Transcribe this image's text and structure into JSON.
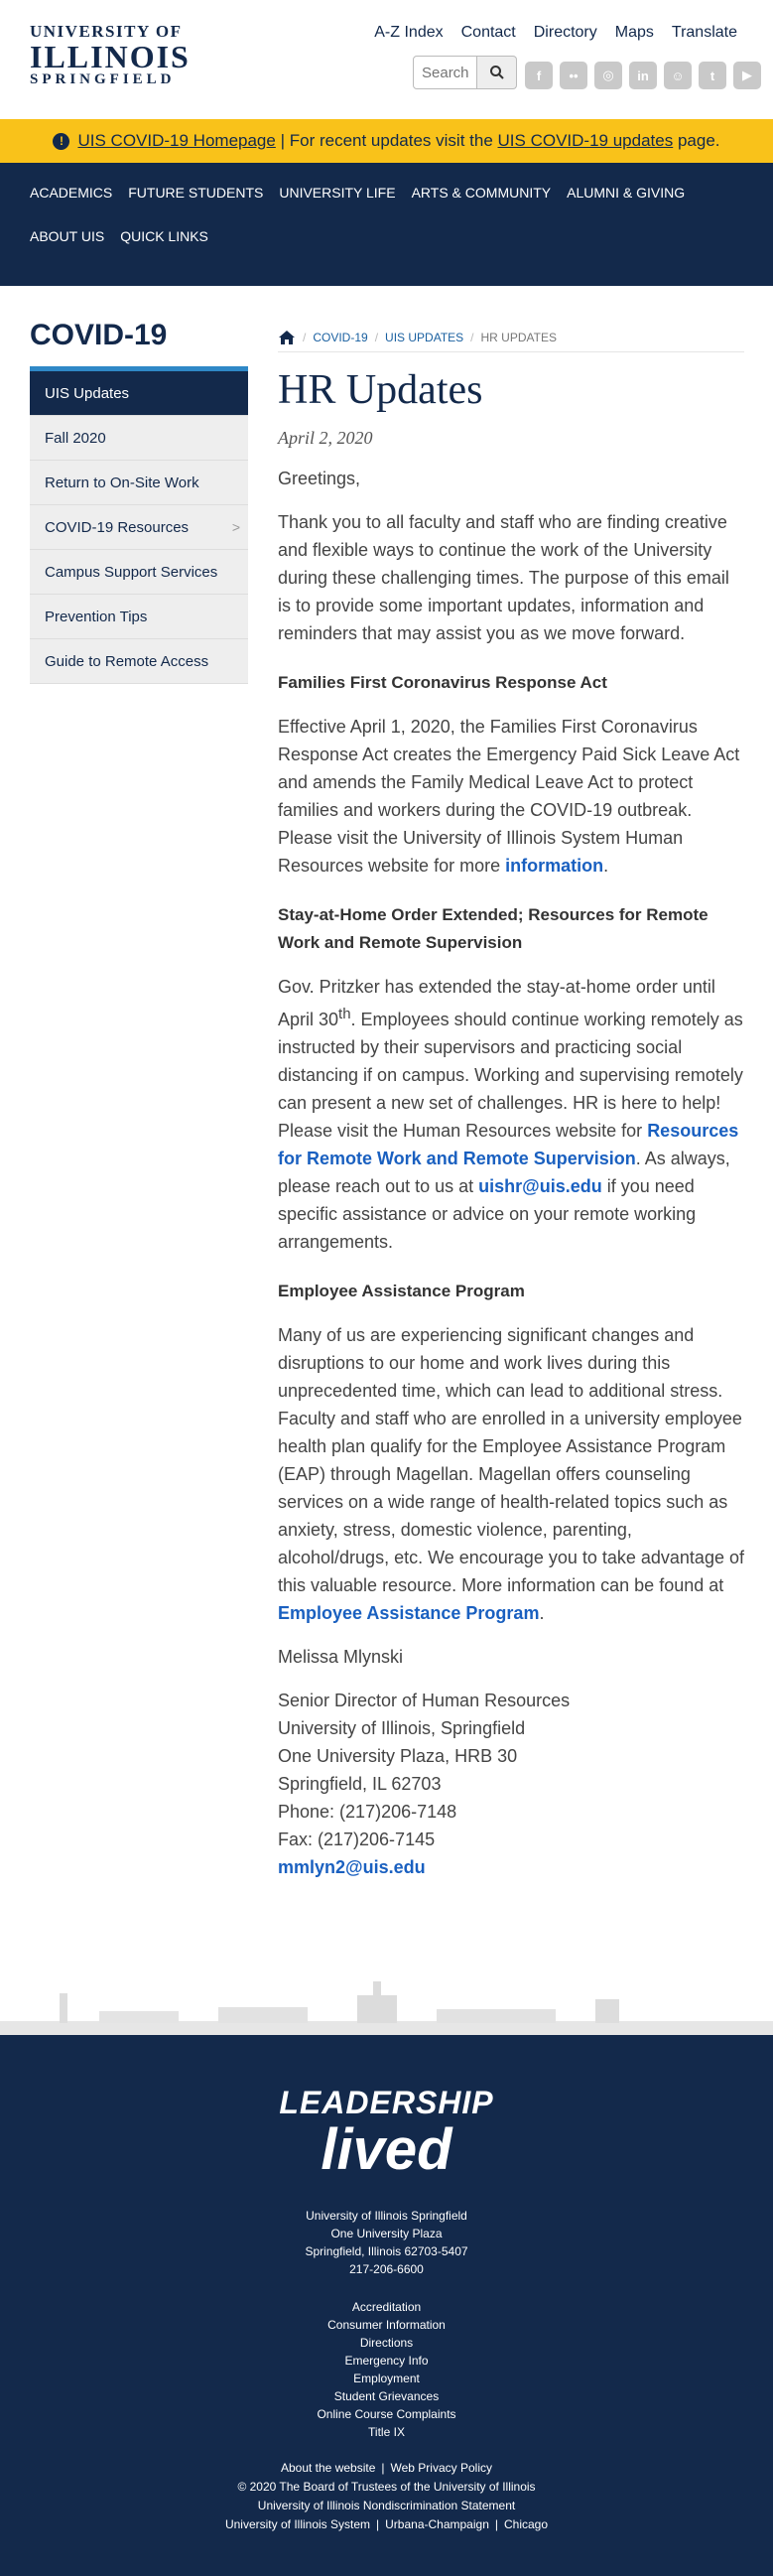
{
  "header": {
    "logo_line1": "UNIVERSITY OF",
    "logo_line2": "ILLINOIS",
    "logo_line3": "SPRINGFIELD",
    "top_links": [
      "A-Z Index",
      "Contact",
      "Directory",
      "Maps",
      "Translate"
    ],
    "search_placeholder": "Search",
    "social": [
      "facebook-icon",
      "flickr-icon",
      "instagram-icon",
      "linkedin-icon",
      "snapchat-icon",
      "twitter-icon",
      "youtube-icon"
    ]
  },
  "alert": {
    "link1": "UIS COVID-19 Homepage",
    "text1": "| For recent updates visit the",
    "link2": "UIS COVID-19 updates",
    "text2": "page."
  },
  "nav": [
    "ACADEMICS",
    "FUTURE STUDENTS",
    "UNIVERSITY LIFE",
    "ARTS & COMMUNITY",
    "ALUMNI & GIVING",
    "ABOUT UIS",
    "QUICK LINKS"
  ],
  "sidebar": {
    "title": "COVID-19",
    "items": [
      "UIS Updates",
      "Fall 2020",
      "Return to On-Site Work",
      "COVID-19 Resources",
      "Campus Support Services",
      "Prevention Tips",
      "Guide to Remote Access"
    ]
  },
  "breadcrumb": [
    "COVID-19",
    "UIS UPDATES",
    "HR UPDATES"
  ],
  "page": {
    "title": "HR Updates",
    "date": "April 2, 2020",
    "greeting": "Greetings,",
    "intro": "Thank you to all faculty and staff who are finding creative and flexible ways to continue the work of the University during these challenging times. The purpose of this email is to provide some important updates, information and reminders that may assist you as we move forward.",
    "h1": "Families First Coronavirus Response Act",
    "p1": "Effective April 1, 2020, the Families First Coronavirus Response Act creates the Emergency Paid Sick Leave Act and amends the Family Medical Leave Act to protect families and workers during the COVID-19 outbreak. Please visit the University of Illinois System Human Resources website for more",
    "p1_link": "information",
    "h2": "Stay-at-Home Order Extended; Resources for Remote Work and Remote Supervision",
    "p2a": "Gov. Pritzker has extended the stay-at-home order until April 30",
    "p2_sup": "th",
    "p2b": ".  Employees should continue working remotely as instructed by their supervisors and practicing social distancing if on campus.  Working and supervising remotely can present a new set of challenges. HR is here to help! Please visit the Human Resources website for",
    "p2_link1": "Resources for Remote Work and Remote Supervision",
    "p2c": ".  As always, please reach out to us at",
    "p2_link2": "uishr@uis.edu",
    "p2d": "if you need specific assistance or advice on your remote working arrangements.",
    "h3": "Employee Assistance Program",
    "p3": "Many of us are experiencing significant changes and disruptions to our home and work lives during this unprecedented time, which can lead to additional stress. Faculty and staff who are enrolled in a university employee health plan qualify for the Employee Assistance Program (EAP) through Magellan. Magellan offers counseling services on a wide range of health-related topics such as anxiety, stress, domestic violence, parenting, alcohol/drugs, etc.  We encourage you to take advantage of this valuable resource. More information can be found at",
    "p3_link": "Employee Assistance Program",
    "signer": "Melissa Mlynski",
    "sig_lines": [
      "Senior Director of Human Resources",
      "University of Illinois, Springfield",
      "One University Plaza, HRB 30",
      "Springfield, IL  62703",
      "Phone:  (217)206-7148",
      "Fax: (217)206-7145"
    ],
    "sig_email": "mmlyn2@uis.edu"
  },
  "footer": {
    "logo1": "LEADERSHIP",
    "logo2": "lived",
    "address": [
      "University of Illinois Springfield",
      "One University Plaza",
      "Springfield, Illinois 62703-5407",
      "217-206-6600"
    ],
    "links": [
      "Accreditation",
      "Consumer Information",
      "Directions",
      "Emergency Info",
      "Employment",
      "Student Grievances",
      "Online Course Complaints",
      "Title IX"
    ],
    "bottom1": [
      "About the website",
      "Web Privacy Policy"
    ],
    "copyright": "© 2020 The Board of Trustees of the University of Illinois",
    "nondisc": "University of Illinois Nondiscrimination Statement",
    "bottom2": [
      "University of Illinois System",
      "Urbana-Champaign",
      "Chicago"
    ]
  }
}
